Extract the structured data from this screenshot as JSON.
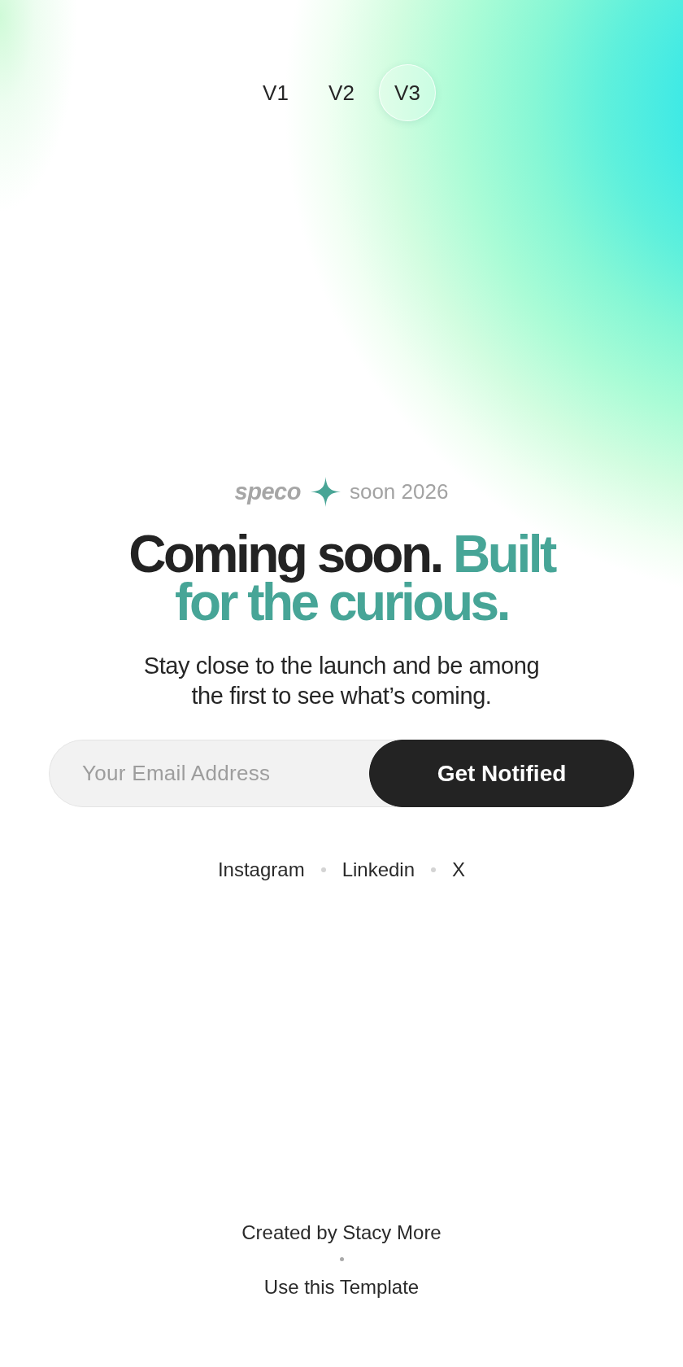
{
  "version_tabs": [
    {
      "label": "V1",
      "selected": false
    },
    {
      "label": "V2",
      "selected": false
    },
    {
      "label": "V3",
      "selected": true
    }
  ],
  "announcement": {
    "brand": "speco",
    "text": "soon 2026"
  },
  "headline": {
    "lead": "Coming soon.",
    "highlight": "Built for the curious."
  },
  "subtitle": "Stay close to the launch and be among the first to see what’s coming.",
  "signup": {
    "placeholder": "Your Email Address",
    "button": "Get Notified"
  },
  "social_links": [
    "Instagram",
    "Linkedin",
    "X"
  ],
  "footer": {
    "credit": "Created by Stacy More",
    "link": "Use this Template"
  }
}
